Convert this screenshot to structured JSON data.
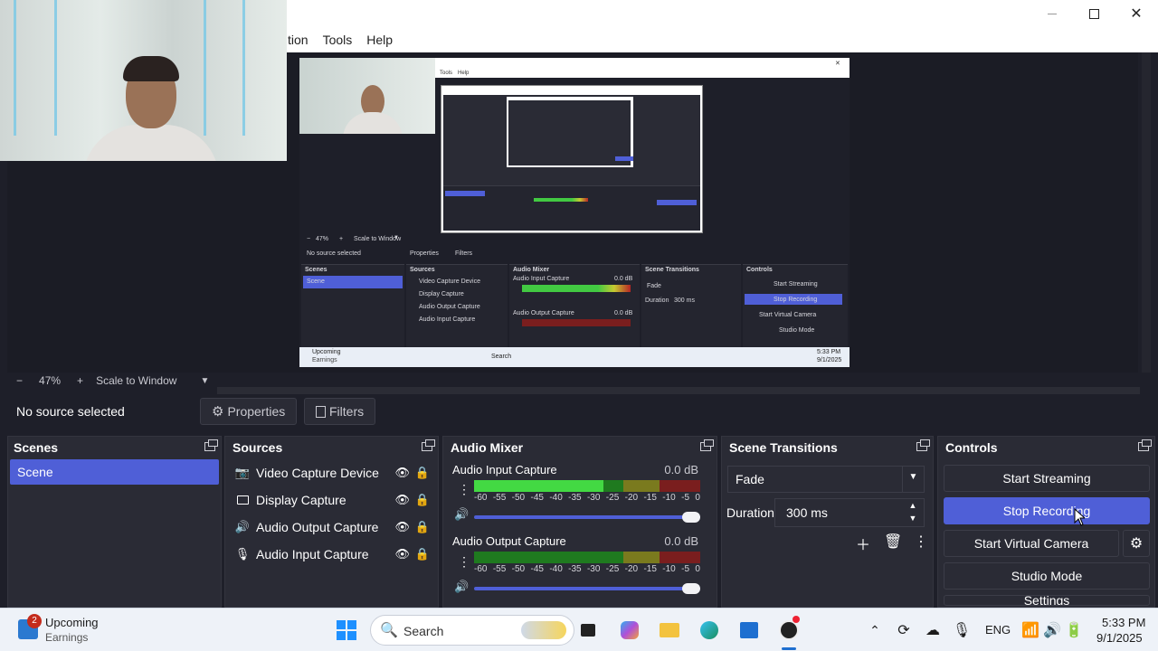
{
  "menu": {
    "partial_item": "tion",
    "tools": "Tools",
    "help": "Help"
  },
  "preview": {
    "mini_menu": [
      "Tools",
      "Help"
    ],
    "mini_zoom": "47%",
    "mini_scale": "Scale to Window",
    "mini_no_source": "No source selected",
    "mini_properties": "Properties",
    "mini_filters": "Filters",
    "mini_docks": [
      "Scenes",
      "Sources",
      "Audio Mixer",
      "Scene Transitions",
      "Controls"
    ],
    "mini_scene": "Scene",
    "mini_sources": [
      "Video Capture Device",
      "Display Capture",
      "Audio Output Capture",
      "Audio Input Capture"
    ],
    "mini_audio": [
      "Audio Input Capture",
      "Audio Output Capture"
    ],
    "mini_db": "0.0 dB",
    "mini_transition": "Fade",
    "mini_duration_label": "Duration",
    "mini_duration": "300 ms",
    "mini_controls": [
      "Start Streaming",
      "Stop Recording",
      "Start Virtual Camera",
      "Studio Mode",
      "Settings"
    ],
    "mini_taskbar_notice": "Upcoming",
    "mini_taskbar_sub": "Earnings",
    "mini_search": "Search",
    "mini_time": "5:33 PM",
    "mini_date": "9/1/2025"
  },
  "zoom": {
    "minus": "−",
    "percent": "47%",
    "plus": "+",
    "scale_mode": "Scale to Window"
  },
  "source_bar": {
    "status": "No source selected",
    "properties": "Properties",
    "filters": "Filters"
  },
  "scenes": {
    "title": "Scenes",
    "items": [
      "Scene"
    ]
  },
  "sources": {
    "title": "Sources",
    "items": [
      {
        "label": "Video Capture Device",
        "icon": "camera-icon",
        "locked": true
      },
      {
        "label": "Display Capture",
        "icon": "monitor-icon",
        "locked": true
      },
      {
        "label": "Audio Output Capture",
        "icon": "speaker-icon",
        "locked": false
      },
      {
        "label": "Audio Input Capture",
        "icon": "microphone-icon",
        "locked": false
      }
    ]
  },
  "audio_mixer": {
    "title": "Audio Mixer",
    "ticks": [
      "-60",
      "-55",
      "-50",
      "-45",
      "-40",
      "-35",
      "-30",
      "-25",
      "-20",
      "-15",
      "-10",
      "-5",
      "0"
    ],
    "channels": [
      {
        "label": "Audio Input Capture",
        "db": "0.0 dB",
        "level": 0.57,
        "volume": 1.0
      },
      {
        "label": "Audio Output Capture",
        "db": "0.0 dB",
        "level": 0.0,
        "volume": 1.0
      }
    ]
  },
  "scene_transitions": {
    "title": "Scene Transitions",
    "transition": "Fade",
    "duration_label": "Duration",
    "duration": "300 ms"
  },
  "controls": {
    "title": "Controls",
    "start_streaming": "Start Streaming",
    "stop_recording": "Stop Recording",
    "start_virtual_camera": "Start Virtual Camera",
    "studio_mode": "Studio Mode",
    "settings": "Settings"
  },
  "taskbar": {
    "widget_title": "Upcoming",
    "widget_sub": "Earnings",
    "widget_badge": "2",
    "search": "Search",
    "language": "ENG",
    "time": "5:33 PM",
    "date": "9/1/2025"
  },
  "colors": {
    "accent": "#4f5fd7",
    "dock_bg": "#2a2b35",
    "panel_bg": "#1e1f29",
    "meter_green": "#43d943"
  }
}
